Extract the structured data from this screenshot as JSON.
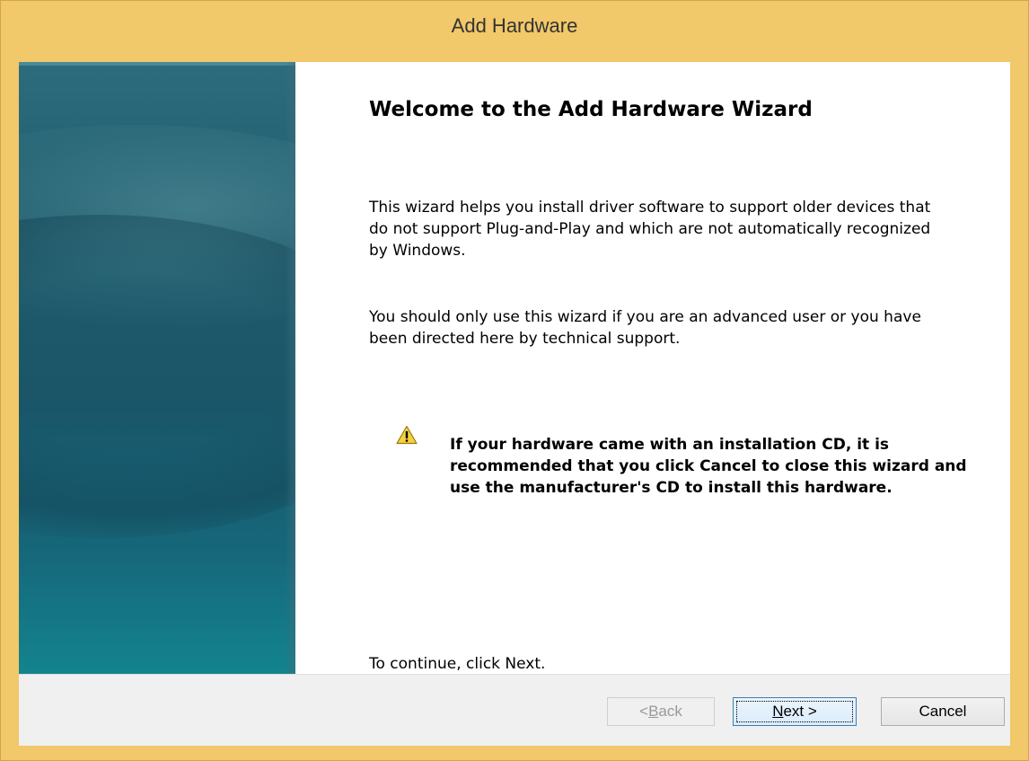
{
  "window": {
    "title": "Add Hardware"
  },
  "wizard": {
    "heading": "Welcome to the Add Hardware Wizard",
    "paragraph1": "This wizard helps you install driver software to support older devices that do not support Plug-and-Play and which are not automatically recognized by Windows.",
    "paragraph2": "You should only use this wizard if you are an advanced user or you have been directed here by technical support.",
    "warning": "If your hardware came with an installation CD, it is recommended that you click Cancel to close this wizard and use the manufacturer's CD to install this hardware.",
    "warning_icon": "warning-triangle-icon",
    "continue_text": "To continue, click Next."
  },
  "buttons": {
    "back_pre": "< ",
    "back_key": "B",
    "back_post": "ack",
    "next_key": "N",
    "next_post": "ext >",
    "cancel": "Cancel"
  },
  "colors": {
    "titlebar": "#f1c86a",
    "banner": "#1f5c6c",
    "footer": "#f0f0f0"
  }
}
